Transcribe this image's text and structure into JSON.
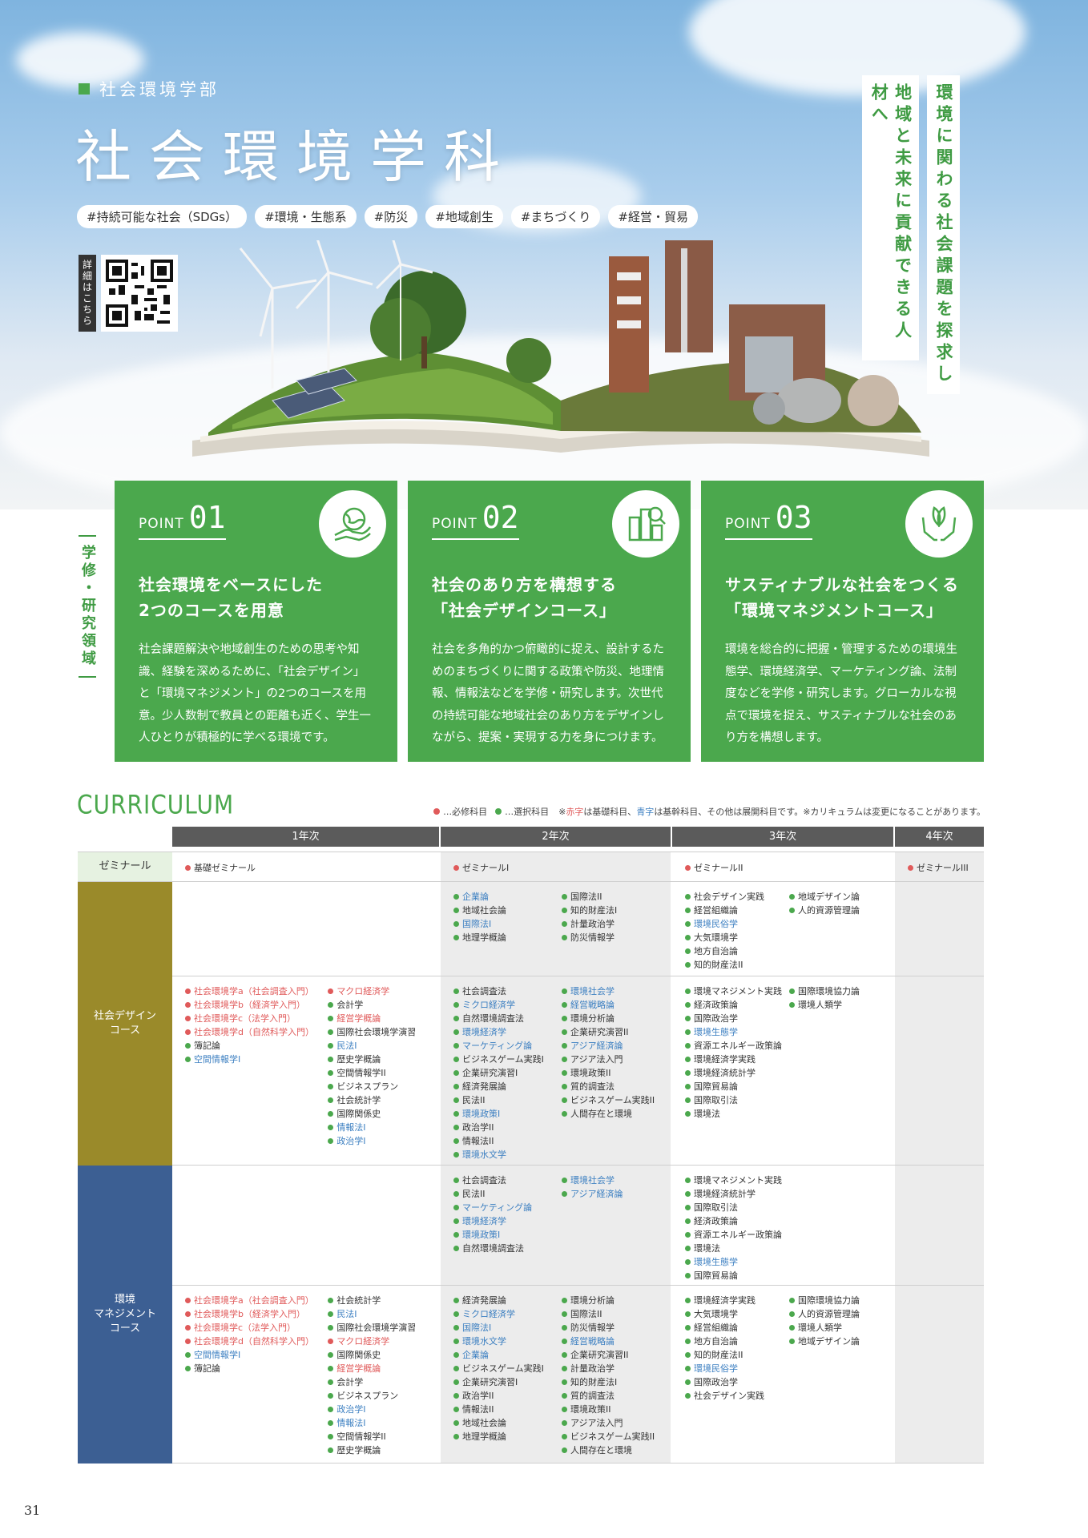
{
  "hero": {
    "dept": "社会環境学部",
    "title": "社会環境学科",
    "tags": [
      "#持続可能な社会（SDGs）",
      "#環境・生態系",
      "#防災",
      "#地域創生",
      "#まちづくり",
      "#経営・貿易"
    ],
    "qr_label": "詳細はこちら",
    "vertical_1": "環境に関わる社会課題を探求し",
    "vertical_2": "地域と未来に貢献できる人材へ"
  },
  "side_label": "学修・研究領域",
  "points": [
    {
      "p": "POINT",
      "num": "01",
      "icon": "globe-hand-icon",
      "title_1": "社会環境をベースにした",
      "title_2": "2つのコースを用意",
      "body": "社会課題解決や地域創生のための思考や知識、経験を深めるために、「社会デザイン」と「環境マネジメント」の2つのコースを用意。少人数制で教員との距離も近く、学生一人ひとりが積極的に学べる環境です。"
    },
    {
      "p": "POINT",
      "num": "02",
      "icon": "city-search-icon",
      "title_1": "社会のあり方を構想する",
      "title_2": "「社会デザインコース」",
      "body": "社会を多角的かつ俯瞰的に捉え、設計するためのまちづくりに関する政策や防災、地理情報、情報法などを学修・研究します。次世代の持続可能な地域社会のあり方をデザインしながら、提案・実現する力を身につけます。"
    },
    {
      "p": "POINT",
      "num": "03",
      "icon": "leaf-hands-icon",
      "title_1": "サスティナブルな社会をつくる",
      "title_2": "「環境マネジメントコース」",
      "body": "環境を総合的に把握・管理するための環境生態学、環境経済学、マーケティング論、法制度などを学修・研究します。グローカルな視点で環境を捉え、サスティナブルな社会のあり方を構想します。"
    }
  ],
  "curriculum": {
    "title": "CURRICULUM",
    "legend": {
      "required": "…必修科目",
      "elective": "…選択科目",
      "note_red": "赤字",
      "note_1": "は基礎科目、",
      "note_blue": "青字",
      "note_2": "は基幹科目、その他は展開科目です。※カリキュラムは変更になることがあります。"
    },
    "years": [
      "1年次",
      "2年次",
      "3年次",
      "4年次"
    ],
    "seminar": {
      "label": "ゼミナール",
      "y1": "基礎ゼミナール",
      "y2": "ゼミナールI",
      "y3": "ゼミナールII",
      "y4": "ゼミナールIII"
    },
    "design_label": "社会デザイン\nコース",
    "env_label": "環境\nマネジメント\nコース",
    "design_top": {
      "y2": [
        [
          [
            "g",
            "b",
            "企業論"
          ],
          [
            "g",
            "",
            "地域社会論"
          ],
          [
            "g",
            "b",
            "国際法I"
          ],
          [
            "g",
            "",
            "地理学概論"
          ]
        ],
        [
          [
            "g",
            "",
            "国際法II"
          ],
          [
            "g",
            "",
            "知的財産法I"
          ],
          [
            "g",
            "",
            "計量政治学"
          ],
          [
            "g",
            "",
            "防災情報学"
          ]
        ]
      ],
      "y3": [
        [
          [
            "g",
            "",
            "社会デザイン実践"
          ],
          [
            "g",
            "",
            "経営組織論"
          ],
          [
            "g",
            "b",
            "環境民俗学"
          ],
          [
            "g",
            "",
            "大気環境学"
          ],
          [
            "g",
            "",
            "地方自治論"
          ],
          [
            "g",
            "",
            "知的財産法II"
          ]
        ],
        [
          [
            "g",
            "",
            "地域デザイン論"
          ],
          [
            "g",
            "",
            "人的資源管理論"
          ]
        ]
      ]
    },
    "design_bottom": {
      "y1": [
        [
          [
            "r",
            "r",
            "社会環境学a（社会調査入門）"
          ],
          [
            "r",
            "r",
            "社会環境学b（経済学入門）"
          ],
          [
            "r",
            "r",
            "社会環境学c（法学入門）"
          ],
          [
            "r",
            "r",
            "社会環境学d（自然科学入門）"
          ],
          [
            "g",
            "",
            "簿記論"
          ],
          [
            "g",
            "b",
            "空間情報学I"
          ]
        ],
        [
          [
            "r",
            "r",
            "マクロ経済学"
          ],
          [
            "g",
            "",
            "会計学"
          ],
          [
            "g",
            "r",
            "経営学概論"
          ],
          [
            "g",
            "",
            "国際社会環境学演習"
          ],
          [
            "g",
            "b",
            "民法I"
          ],
          [
            "g",
            "",
            "歴史学概論"
          ],
          [
            "g",
            "",
            "空間情報学II"
          ],
          [
            "g",
            "",
            "ビジネスプラン"
          ],
          [
            "g",
            "",
            "社会統計学"
          ],
          [
            "g",
            "",
            "国際関係史"
          ],
          [
            "g",
            "b",
            "情報法I"
          ],
          [
            "g",
            "b",
            "政治学I"
          ]
        ]
      ],
      "y2": [
        [
          [
            "g",
            "",
            "社会調査法"
          ],
          [
            "g",
            "b",
            "ミクロ経済学"
          ],
          [
            "g",
            "",
            "自然環境調査法"
          ],
          [
            "g",
            "b",
            "環境経済学"
          ],
          [
            "g",
            "b",
            "マーケティング論"
          ],
          [
            "g",
            "",
            "ビジネスゲーム実践I"
          ],
          [
            "g",
            "",
            "企業研究演習I"
          ],
          [
            "g",
            "",
            "経済発展論"
          ],
          [
            "g",
            "",
            "民法II"
          ],
          [
            "g",
            "b",
            "環境政策I"
          ],
          [
            "g",
            "",
            "政治学II"
          ],
          [
            "g",
            "",
            "情報法II"
          ],
          [
            "g",
            "b",
            "環境水文学"
          ]
        ],
        [
          [
            "g",
            "b",
            "環境社会学"
          ],
          [
            "g",
            "b",
            "経営戦略論"
          ],
          [
            "g",
            "",
            "環境分析論"
          ],
          [
            "g",
            "",
            "企業研究演習II"
          ],
          [
            "g",
            "b",
            "アジア経済論"
          ],
          [
            "g",
            "",
            "アジア法入門"
          ],
          [
            "g",
            "",
            "環境政策II"
          ],
          [
            "g",
            "",
            "質的調査法"
          ],
          [
            "g",
            "",
            "ビジネスゲーム実践II"
          ],
          [
            "g",
            "",
            "人間存在と環境"
          ]
        ]
      ],
      "y3": [
        [
          [
            "g",
            "",
            "環境マネジメント実践"
          ],
          [
            "g",
            "",
            "経済政策論"
          ],
          [
            "g",
            "",
            "国際政治学"
          ],
          [
            "g",
            "b",
            "環境生態学"
          ],
          [
            "g",
            "",
            "資源エネルギー政策論"
          ],
          [
            "g",
            "",
            "環境経済学実践"
          ],
          [
            "g",
            "",
            "環境経済統計学"
          ],
          [
            "g",
            "",
            "国際貿易論"
          ],
          [
            "g",
            "",
            "国際取引法"
          ],
          [
            "g",
            "",
            "環境法"
          ]
        ],
        [
          [
            "g",
            "",
            "国際環境協力論"
          ],
          [
            "g",
            "",
            "環境人類学"
          ]
        ]
      ]
    },
    "env_top": {
      "y2": [
        [
          [
            "g",
            "",
            "社会調査法"
          ],
          [
            "g",
            "",
            "民法II"
          ],
          [
            "g",
            "b",
            "マーケティング論"
          ],
          [
            "g",
            "b",
            "環境経済学"
          ],
          [
            "g",
            "b",
            "環境政策I"
          ],
          [
            "g",
            "",
            "自然環境調査法"
          ]
        ],
        [
          [
            "g",
            "b",
            "環境社会学"
          ],
          [
            "g",
            "b",
            "アジア経済論"
          ]
        ]
      ],
      "y3": [
        [
          [
            "g",
            "",
            "環境マネジメント実践"
          ],
          [
            "g",
            "",
            "環境経済統計学"
          ],
          [
            "g",
            "",
            "国際取引法"
          ],
          [
            "g",
            "",
            "経済政策論"
          ],
          [
            "g",
            "",
            "資源エネルギー政策論"
          ],
          [
            "g",
            "",
            "環境法"
          ],
          [
            "g",
            "b",
            "環境生態学"
          ],
          [
            "g",
            "",
            "国際貿易論"
          ]
        ]
      ]
    },
    "env_bottom": {
      "y1": [
        [
          [
            "r",
            "r",
            "社会環境学a（社会調査入門）"
          ],
          [
            "r",
            "r",
            "社会環境学b（経済学入門）"
          ],
          [
            "r",
            "r",
            "社会環境学c（法学入門）"
          ],
          [
            "r",
            "r",
            "社会環境学d（自然科学入門）"
          ],
          [
            "g",
            "b",
            "空間情報学I"
          ],
          [
            "g",
            "",
            "簿記論"
          ]
        ],
        [
          [
            "g",
            "",
            "社会統計学"
          ],
          [
            "g",
            "b",
            "民法I"
          ],
          [
            "g",
            "",
            "国際社会環境学演習"
          ],
          [
            "r",
            "r",
            "マクロ経済学"
          ],
          [
            "g",
            "",
            "国際関係史"
          ],
          [
            "g",
            "r",
            "経営学概論"
          ],
          [
            "g",
            "",
            "会計学"
          ],
          [
            "g",
            "",
            "ビジネスプラン"
          ],
          [
            "g",
            "b",
            "政治学I"
          ],
          [
            "g",
            "b",
            "情報法I"
          ],
          [
            "g",
            "",
            "空間情報学II"
          ],
          [
            "g",
            "",
            "歴史学概論"
          ]
        ]
      ],
      "y2": [
        [
          [
            "g",
            "",
            "経済発展論"
          ],
          [
            "g",
            "b",
            "ミクロ経済学"
          ],
          [
            "g",
            "b",
            "国際法I"
          ],
          [
            "g",
            "b",
            "環境水文学"
          ],
          [
            "g",
            "b",
            "企業論"
          ],
          [
            "g",
            "",
            "ビジネスゲーム実践I"
          ],
          [
            "g",
            "",
            "企業研究演習I"
          ],
          [
            "g",
            "",
            "政治学II"
          ],
          [
            "g",
            "",
            "情報法II"
          ],
          [
            "g",
            "",
            "地域社会論"
          ],
          [
            "g",
            "",
            "地理学概論"
          ]
        ],
        [
          [
            "g",
            "",
            "環境分析論"
          ],
          [
            "g",
            "",
            "国際法II"
          ],
          [
            "g",
            "",
            "防災情報学"
          ],
          [
            "g",
            "b",
            "経営戦略論"
          ],
          [
            "g",
            "",
            "企業研究演習II"
          ],
          [
            "g",
            "",
            "計量政治学"
          ],
          [
            "g",
            "",
            "知的財産法I"
          ],
          [
            "g",
            "",
            "質的調査法"
          ],
          [
            "g",
            "",
            "環境政策II"
          ],
          [
            "g",
            "",
            "アジア法入門"
          ],
          [
            "g",
            "",
            "ビジネスゲーム実践II"
          ],
          [
            "g",
            "",
            "人間存在と環境"
          ]
        ]
      ],
      "y3": [
        [
          [
            "g",
            "",
            "環境経済学実践"
          ],
          [
            "g",
            "",
            "大気環境学"
          ],
          [
            "g",
            "",
            "経営組織論"
          ],
          [
            "g",
            "",
            "地方自治論"
          ],
          [
            "g",
            "",
            "知的財産法II"
          ],
          [
            "g",
            "b",
            "環境民俗学"
          ],
          [
            "g",
            "",
            "国際政治学"
          ],
          [
            "g",
            "",
            "社会デザイン実践"
          ]
        ],
        [
          [
            "g",
            "",
            "国際環境協力論"
          ],
          [
            "g",
            "",
            "人的資源管理論"
          ],
          [
            "g",
            "",
            "環境人類学"
          ],
          [
            "g",
            "",
            "地域デザイン論"
          ]
        ]
      ]
    }
  },
  "page_number": "31"
}
